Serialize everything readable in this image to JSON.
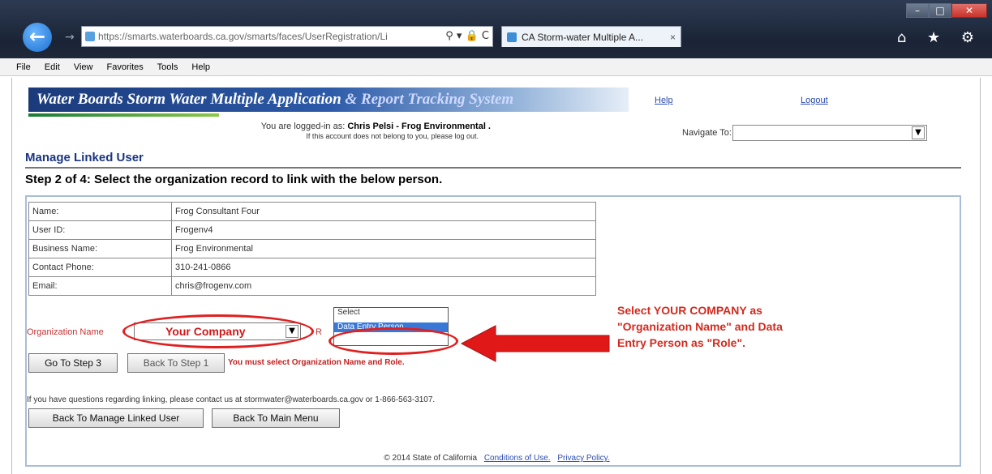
{
  "browser": {
    "url": "https://smarts.waterboards.ca.gov/smarts/faces/UserRegistration/Li",
    "tab_title": "CA Storm-water Multiple A...",
    "tab_close": "×",
    "window_buttons": [
      "–",
      "□",
      "✕"
    ],
    "addr_tools": "⚲ ▾ 🔒 C",
    "right_icons": "⌂ ★ ⚙",
    "menu": [
      "File",
      "Edit",
      "View",
      "Favorites",
      "Tools",
      "Help"
    ]
  },
  "header": {
    "banner_main": "Water Boards Storm Water Multiple Application",
    "banner_accent": " & Report Tracking System",
    "help_link": "Help",
    "logout_link": "Logout",
    "logged_in_prefix": "You are logged-in as: ",
    "logged_in_user": "Chris Pelsi - Frog Environmental .",
    "logged_in_note": "If this account does not belong to you, please log out.",
    "navigate_label": "Navigate To:",
    "navigate_value": ""
  },
  "page": {
    "section_title": "Manage Linked User",
    "step_title": "Step 2 of 4: Select the organization record to link with the below person."
  },
  "person": {
    "rows": [
      {
        "label": "Name:",
        "value": "Frog Consultant Four"
      },
      {
        "label": "User ID:",
        "value": "Frogenv4"
      },
      {
        "label": "Business Name:",
        "value": "Frog Environmental"
      },
      {
        "label": "Contact Phone:",
        "value": "310-241-0866"
      },
      {
        "label": "Email:",
        "value": "chris@frogenv.com"
      }
    ]
  },
  "form": {
    "org_label": "Organization Name",
    "org_value": "Your Company",
    "role_label": "R",
    "role_options": [
      "Select",
      "Data Entry Person"
    ],
    "role_selected": "Data Entry Person",
    "step3_button": "Go To Step 3",
    "step1_button": "Back To Step 1",
    "error_message": "You must select Organization Name and Role.",
    "contact_message": "If you have questions regarding linking, please contact us at stormwater@waterboards.ca.gov or 1-866-563-3107.",
    "back_linked_button": "Back To Manage Linked User",
    "back_main_button": "Back To Main Menu"
  },
  "footer": {
    "copyright": "© 2014 State of California",
    "conditions_link": "Conditions of Use.",
    "privacy_link": "Privacy Policy."
  },
  "annotation": {
    "text": "Select YOUR COMPANY as \"Organization Name\" and Data Entry Person as \"Role\".",
    "color": "#d42a1e"
  }
}
